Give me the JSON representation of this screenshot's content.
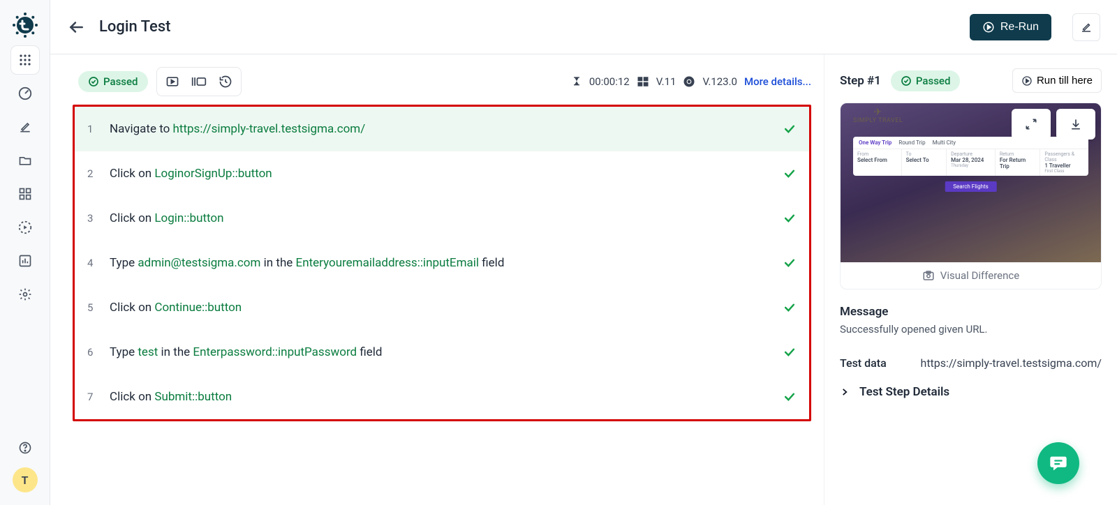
{
  "header": {
    "title": "Login Test",
    "rerun_label": "Re-Run"
  },
  "toolbar": {
    "status": "Passed",
    "duration": "00:00:12",
    "os_version": "V.11",
    "browser_version": "V.123.0",
    "more_details": "More details..."
  },
  "steps": [
    {
      "n": "1",
      "parts": [
        {
          "t": "black",
          "v": "Navigate to "
        },
        {
          "t": "link",
          "v": "https://simply-travel.testsigma.com/"
        }
      ]
    },
    {
      "n": "2",
      "parts": [
        {
          "t": "black",
          "v": "Click on "
        },
        {
          "t": "link",
          "v": "LoginorSignUp::button"
        }
      ]
    },
    {
      "n": "3",
      "parts": [
        {
          "t": "black",
          "v": "Click on "
        },
        {
          "t": "link",
          "v": "Login::button"
        }
      ]
    },
    {
      "n": "4",
      "parts": [
        {
          "t": "black",
          "v": "Type "
        },
        {
          "t": "link",
          "v": "admin@testsigma.com"
        },
        {
          "t": "black",
          "v": " in the "
        },
        {
          "t": "link",
          "v": "Enteryouremailaddress::inputEmail"
        },
        {
          "t": "black",
          "v": " field"
        }
      ]
    },
    {
      "n": "5",
      "parts": [
        {
          "t": "black",
          "v": "Click on "
        },
        {
          "t": "link",
          "v": "Continue::button"
        }
      ]
    },
    {
      "n": "6",
      "parts": [
        {
          "t": "black",
          "v": "Type "
        },
        {
          "t": "link",
          "v": "test"
        },
        {
          "t": "black",
          "v": " in the "
        },
        {
          "t": "link",
          "v": "Enterpassword::inputPassword"
        },
        {
          "t": "black",
          "v": " field"
        }
      ]
    },
    {
      "n": "7",
      "parts": [
        {
          "t": "black",
          "v": "Click on "
        },
        {
          "t": "link",
          "v": "Submit::button"
        }
      ]
    }
  ],
  "right": {
    "step_heading": "Step #1",
    "status": "Passed",
    "run_till": "Run till here",
    "visual_difference": "Visual Difference",
    "message_h": "Message",
    "message_body": "Successfully opened given URL.",
    "test_data_h": "Test data",
    "test_data_v": "https://simply-travel.testsigma.com/",
    "details": "Test Step Details"
  },
  "screenshot": {
    "brand": "SIMPLY TRAVEL",
    "trip_options": [
      "One Way Trip",
      "Round Trip",
      "Multi City"
    ],
    "from_h": "From",
    "from_v": "Select From",
    "to_h": "To",
    "to_v": "Select To",
    "dep_h": "Departure",
    "dep_v": "Mar 28, 2024",
    "dep_sub": "Thursday",
    "ret_h": "Return",
    "ret_v": "For Return Trip",
    "pax_h": "Passengers & Class",
    "pax_v": "1 Traveller",
    "pax_sub": "First Class",
    "search": "Search Flights"
  },
  "avatar": "T"
}
